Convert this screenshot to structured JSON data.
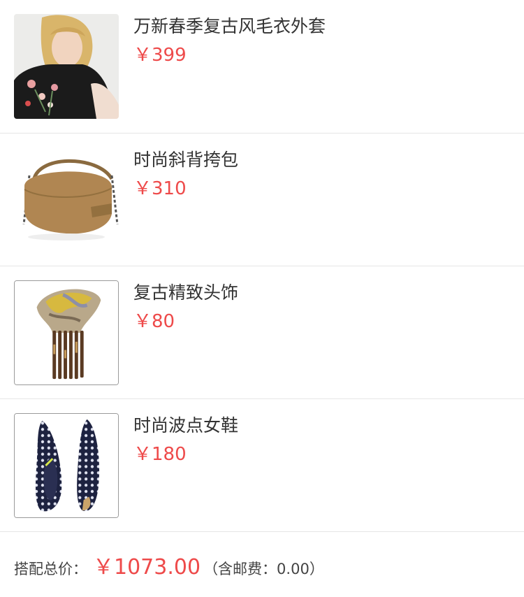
{
  "products": [
    {
      "name": "万新春季复古风毛衣外套",
      "price": "￥399",
      "image": "model-in-embroidered-sweater"
    },
    {
      "name": "时尚斜背挎包",
      "price": "￥310",
      "image": "suede-crossbody-bag"
    },
    {
      "name": "复古精致头饰",
      "price": "￥80",
      "image": "vintage-hair-comb"
    },
    {
      "name": "时尚波点女鞋",
      "price": "￥180",
      "image": "polka-dot-flats"
    }
  ],
  "summary": {
    "label": "搭配总价：",
    "total": "￥1073.00",
    "shipping": "（含邮费：0.00）"
  },
  "colors": {
    "price": "#ee4a4a",
    "divider": "#e6e6e6",
    "text": "#333333"
  }
}
